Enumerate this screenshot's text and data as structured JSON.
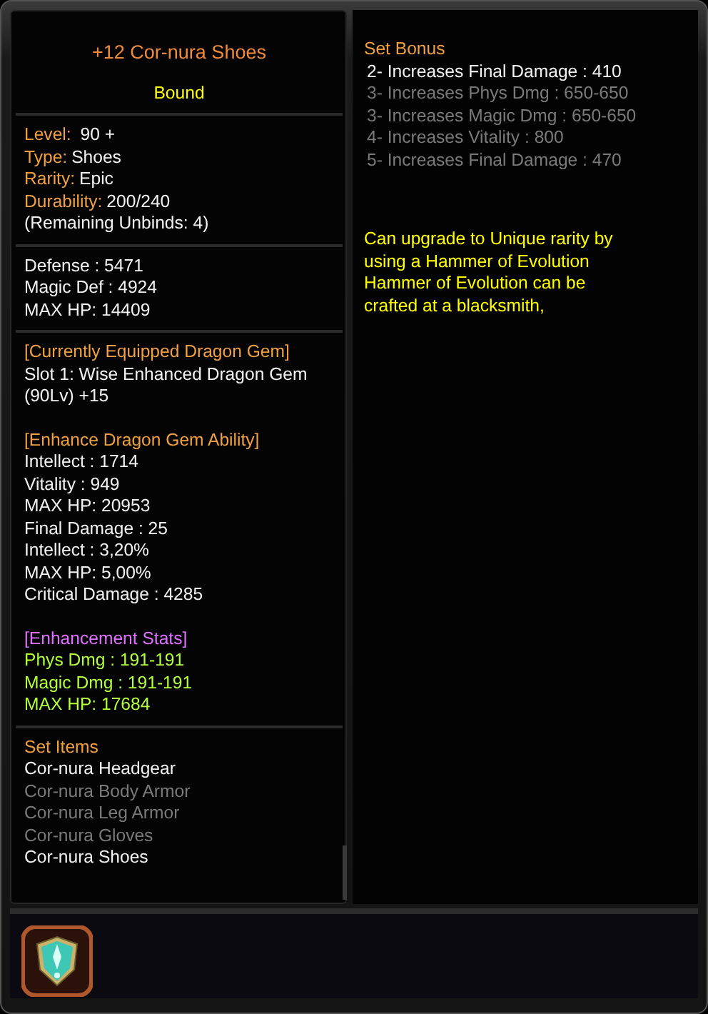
{
  "item": {
    "title": "+12 Cor-nura Shoes",
    "binding": "Bound"
  },
  "basic": [
    {
      "label": "Level:",
      "value": " 90 +"
    },
    {
      "label": "Type:",
      "value": "Shoes"
    },
    {
      "label": "Rarity:",
      "value": "Epic"
    },
    {
      "label": "Durability:",
      "value": "200/240"
    }
  ],
  "unbinds": "(Remaining Unbinds: 4)",
  "stats": [
    "Defense : 5471",
    "Magic Def : 4924",
    "MAX HP: 14409"
  ],
  "dragon_gem": {
    "heading": "[Currently Equipped Dragon Gem]",
    "lines": [
      "Slot 1: Wise Enhanced Dragon Gem",
      "(90Lv) +15"
    ]
  },
  "gem_ability": {
    "heading": "[Enhance Dragon Gem Ability]",
    "lines": [
      "Intellect : 1714",
      "Vitality : 949",
      "MAX HP: 20953",
      "Final Damage : 25",
      "Intellect : 3,20%",
      "MAX HP: 5,00%",
      "Critical Damage : 4285"
    ]
  },
  "enhancement": {
    "heading": "[Enhancement Stats]",
    "lines": [
      "Phys Dmg : 191-191",
      "Magic Dmg : 191-191",
      "MAX HP: 17684"
    ]
  },
  "set_items": {
    "heading": "Set Items",
    "items": [
      {
        "name": "Cor-nura Headgear",
        "active": true
      },
      {
        "name": "Cor-nura Body Armor",
        "active": false
      },
      {
        "name": "Cor-nura Leg Armor",
        "active": false
      },
      {
        "name": "Cor-nura Gloves",
        "active": false
      },
      {
        "name": "Cor-nura Shoes",
        "active": true
      }
    ]
  },
  "set_bonus": {
    "heading": "Set Bonus",
    "bonuses": [
      {
        "text": "2- Increases Final Damage : 410",
        "active": true
      },
      {
        "text": "3- Increases Phys Dmg : 650-650",
        "active": false
      },
      {
        "text": "3- Increases Magic Dmg : 650-650",
        "active": false
      },
      {
        "text": "4- Increases Vitality : 800",
        "active": false
      },
      {
        "text": "5- Increases Final Damage : 470",
        "active": false
      }
    ]
  },
  "upgrade_note": "Can upgrade to Unique rarity by\nusing a Hammer of Evolution\nHammer of Evolution can be\ncrafted at a blacksmith,"
}
